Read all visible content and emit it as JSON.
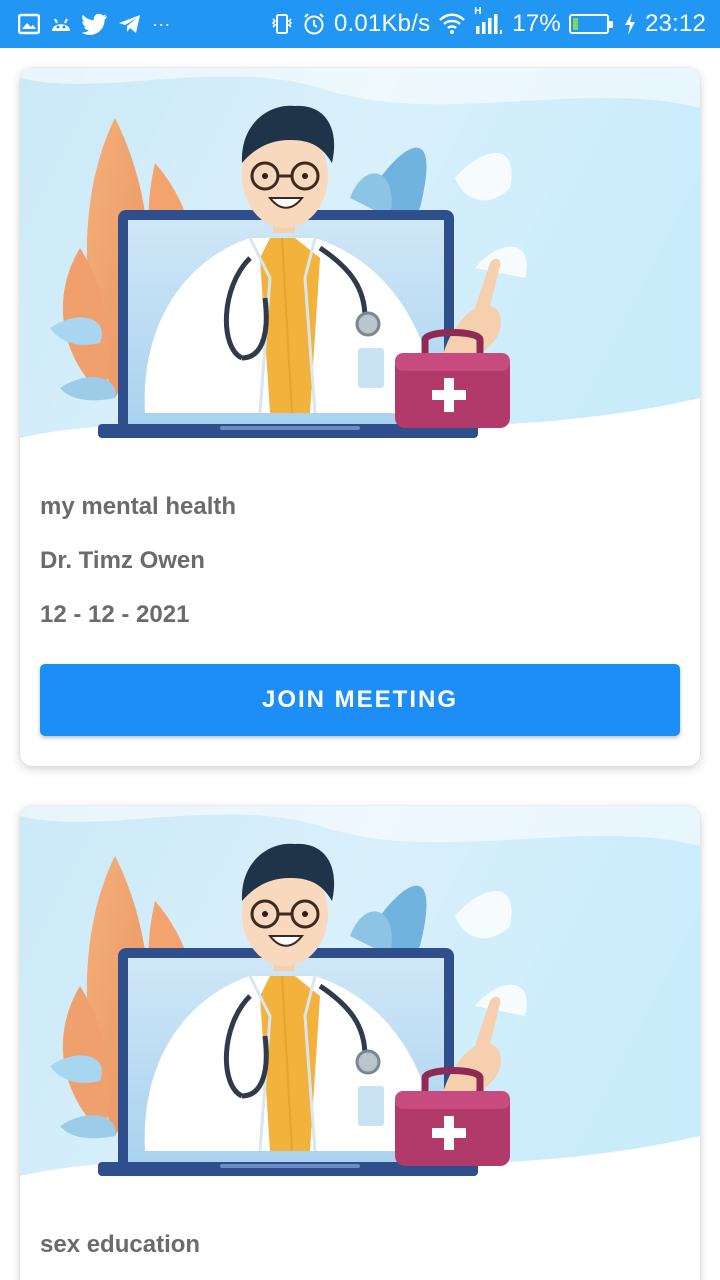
{
  "status_bar": {
    "icons_left": [
      "gallery-icon",
      "android-icon",
      "twitter-icon",
      "telegram-icon",
      "more-icon"
    ],
    "more_text": "···",
    "network_speed": "0.01Kb/s",
    "signal_label": "H",
    "battery_percent": "17%",
    "battery_level": 0.17,
    "time": "23:12",
    "colors": {
      "background": "#2196f3",
      "battery_fill": "#7ed957"
    }
  },
  "meetings": [
    {
      "title": "my mental health",
      "doctor": "Dr. Timz Owen",
      "date": "12 - 12 - 2021",
      "button_label": "JOIN MEETING",
      "image": "doctor-telemedicine-illustration"
    },
    {
      "title": "sex education",
      "image": "doctor-telemedicine-illustration"
    }
  ],
  "colors": {
    "accent": "#1e8ef7",
    "text": "#6b6b6b"
  }
}
